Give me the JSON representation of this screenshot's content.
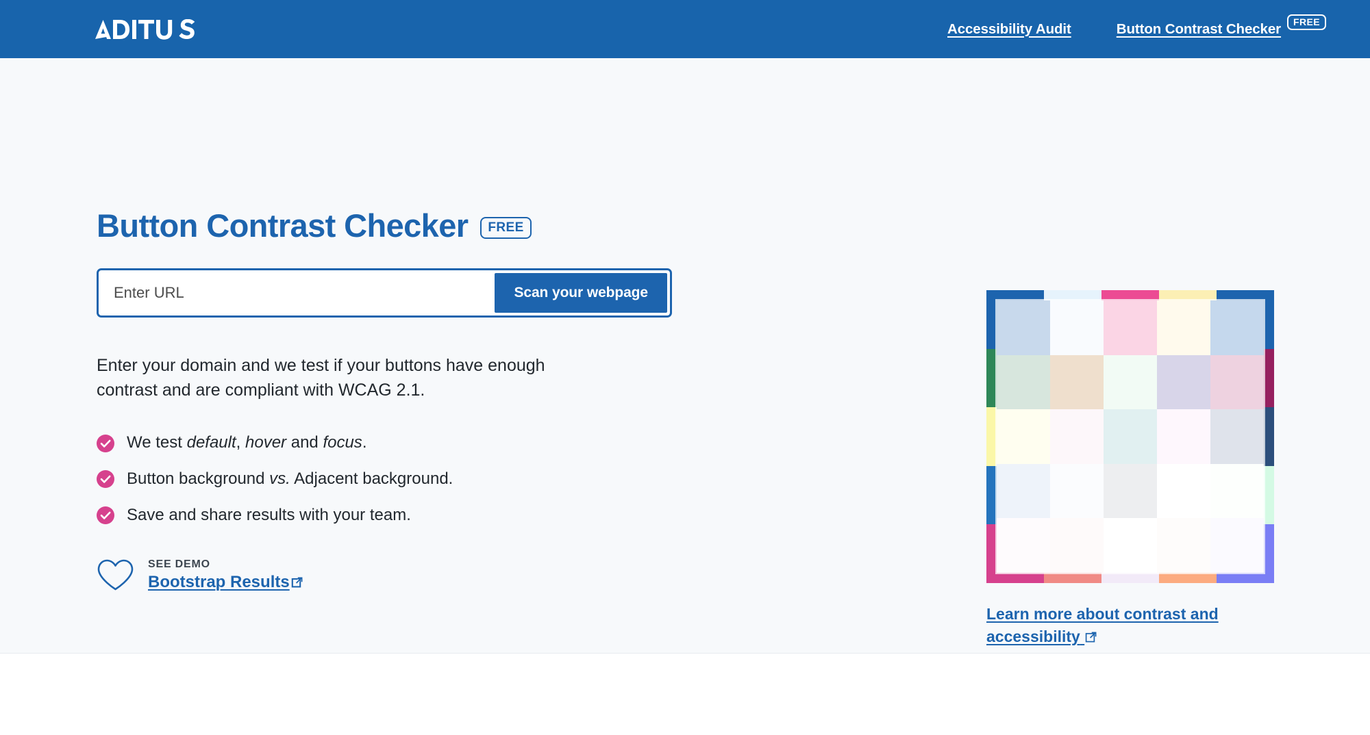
{
  "header": {
    "brand": "ADITUS",
    "brand_icon": "aditus-logo",
    "nav": [
      {
        "label": "Accessibility Audit",
        "badge": null
      },
      {
        "label": "Button Contrast Checker",
        "badge": "FREE"
      }
    ]
  },
  "hero": {
    "title": "Button Contrast Checker",
    "title_badge": "FREE",
    "form": {
      "placeholder": "Enter URL",
      "value": "",
      "submit_label": "Scan your webpage"
    },
    "description": "Enter your domain and we test if your buttons have enough contrast and are compliant with WCAG 2.1.",
    "features": [
      {
        "icon": "check-circle-icon",
        "html": "We test <em>default</em>, <em>hover</em> and <em>focus</em>."
      },
      {
        "icon": "check-circle-icon",
        "html": "Button background <em>vs.</em> Adjacent background."
      },
      {
        "icon": "check-circle-icon",
        "html": "Save and share results with your team."
      }
    ],
    "demo": {
      "icon": "heart-icon",
      "label": "SEE DEMO",
      "link_text": "Bootstrap Results",
      "link_icon": "external-link-icon"
    },
    "aside": {
      "link_text": "Learn more about contrast and accessibility",
      "link_icon": "external-link-icon",
      "grid_alt": "color-contrast-swatch-grid"
    }
  },
  "colors": {
    "brand_blue": "#1864ac",
    "accent_blue": "#1d64ae",
    "accent_pink": "#d6418d",
    "hero_background": "#f7f9fb",
    "text": "#22282e",
    "white": "#ffffff"
  },
  "swatch_grid": {
    "frame": [
      "#1d64ae",
      "#e6f3fc",
      "#ec4b93",
      "#fcefb4",
      "#1d64ae",
      "#2e8758",
      "#d9e3ec",
      "#eef8f1",
      "#d6d3e8",
      "#96205f",
      "#fbf7a8",
      "#fdf5f7",
      "#dff0f2",
      "#fdf5fc",
      "#2c4f7c",
      "#2574bd",
      "#f4f7fb",
      "#eceef0",
      "#ffffff",
      "#d4fae4",
      "#d6418d",
      "#f08a85",
      "#f2eaf8",
      "#fcab80",
      "#7a7ef5"
    ],
    "inner": [
      "#c8d9ec",
      "#f9fbfe",
      "#fbd5e5",
      "#fffaed",
      "#c5d8ed",
      "#d7e6dd",
      "#efdfcd",
      "#f2fbf5",
      "#d8d5e9",
      "#eed2e0",
      "#fffef0",
      "#fdf7fa",
      "#e1f0f1",
      "#fef7fd",
      "#dfe3eb",
      "#eef3fa",
      "#fbfcfe",
      "#edeef0",
      "#ffffff",
      "#fdfffd",
      "#fefbfd",
      "#fefafa",
      "#ffffff",
      "#fefcfb",
      "#fbfaff"
    ]
  }
}
